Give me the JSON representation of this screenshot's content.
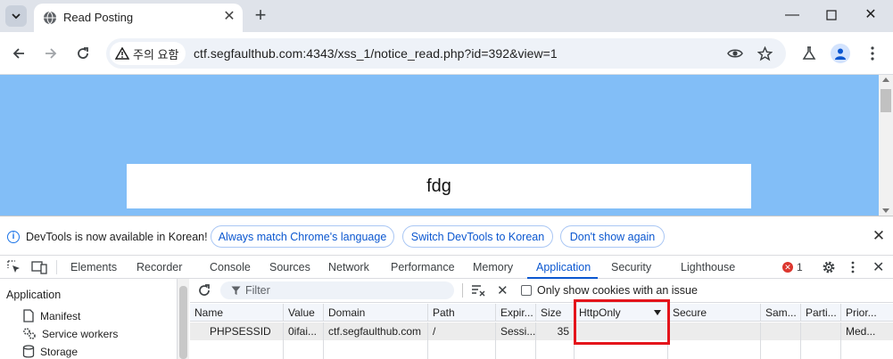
{
  "browser": {
    "tab_title": "Read Posting",
    "security_label": "주의 요함",
    "url": "ctf.segfaulthub.com:4343/xss_1/notice_read.php?id=392&view=1"
  },
  "page": {
    "notice_text": "fdg"
  },
  "infobar": {
    "message": "DevTools is now available in Korean!",
    "buttons": [
      "Always match Chrome's language",
      "Switch DevTools to Korean",
      "Don't show again"
    ]
  },
  "devtools": {
    "tabs": [
      "Elements",
      "Recorder",
      "Console",
      "Sources",
      "Network",
      "Performance",
      "Memory",
      "Application",
      "Security",
      "Lighthouse"
    ],
    "active_tab": "Application",
    "error_count": "1"
  },
  "sidebar": {
    "heading": "Application",
    "items": [
      "Manifest",
      "Service workers",
      "Storage"
    ]
  },
  "cookies": {
    "filter_placeholder": "Filter",
    "issue_checkbox_label": "Only show cookies with an issue",
    "columns": [
      "Name",
      "Value",
      "Domain",
      "Path",
      "Expir...",
      "Size",
      "HttpOnly",
      "Secure",
      "Sam...",
      "Parti...",
      "Prior..."
    ],
    "rows": [
      [
        "PHPSESSID",
        "0ifai...",
        "ctf.segfaulthub.com",
        "/",
        "Sessi...",
        "35",
        "",
        "",
        "",
        "",
        "Med..."
      ]
    ]
  },
  "colors": {
    "page_background": "#82bef7",
    "accent": "#0b57d0",
    "highlight_box": "#e4141b"
  }
}
